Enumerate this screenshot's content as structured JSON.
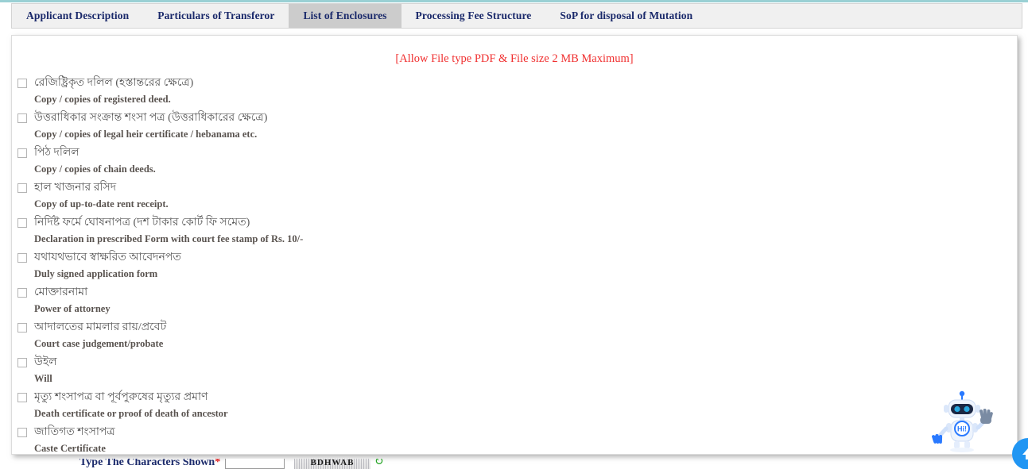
{
  "window": {
    "active_tab": "List of Enclosures"
  },
  "tabs": [
    {
      "label": "Applicant Description",
      "active": false
    },
    {
      "label": "Particulars of Transferor",
      "active": false
    },
    {
      "label": "List of Enclosures",
      "active": true
    },
    {
      "label": "Processing Fee Structure",
      "active": false
    },
    {
      "label": "SoP for disposal of Mutation",
      "active": false
    }
  ],
  "notice": "[Allow File type PDF & File size 2 MB Maximum]",
  "enclosures": [
    {
      "bn": "রেজিষ্ট্রিকৃত দলিল (হস্তান্তরের ক্ষেত্রে)",
      "en": "Copy / copies of registered deed.",
      "checked": false
    },
    {
      "bn": "উত্তরাধিকার সংক্রান্ত শংসা পত্র (উত্তরাধিকারের ক্ষেত্রে)",
      "en": "Copy / copies of legal heir certificate / hebanama etc.",
      "checked": false
    },
    {
      "bn": "পিঠ দলিল",
      "en": "Copy / copies of chain deeds.",
      "checked": false
    },
    {
      "bn": "হাল খাজনার রসিদ",
      "en": "Copy of up-to-date rent receipt.",
      "checked": false
    },
    {
      "bn": "নির্দিষ্ট ফর্মে ঘোষনাপত্র (দশ টাকার কোর্ট ফি সমেত)",
      "en": "Declaration in prescribed Form with court fee stamp of Rs. 10/-",
      "checked": false
    },
    {
      "bn": "যথাযথভাবে স্বাক্ষরিত আবেদনপত",
      "en": "Duly signed application form",
      "checked": false
    },
    {
      "bn": "মোক্তারনামা",
      "en": "Power of attorney",
      "checked": false
    },
    {
      "bn": "আদালতের মামলার রায়/প্রবেট",
      "en": "Court case judgement/probate",
      "checked": false
    },
    {
      "bn": "উইল",
      "en": "Will",
      "checked": false
    },
    {
      "bn": "মৃত্যু শংসাপত্র বা পূর্বপুরুষের মৃত্যুর প্রমাণ",
      "en": "Death certificate or proof of death of ancestor",
      "checked": false
    },
    {
      "bn": "জাতিগত শংসাপত্র",
      "en": "Caste Certificate",
      "checked": false
    }
  ],
  "captcha": {
    "label": "Type The Characters Shown",
    "required_mark": "*",
    "input_value": "",
    "input_placeholder": "",
    "image_text": "BDHWAB",
    "refresh_icon": "refresh-icon"
  },
  "widgets": {
    "chat_robot": {
      "icon": "chat-robot-icon",
      "chest_label": "Hi!"
    },
    "scroll_top": {
      "icon": "arrow-up-icon"
    }
  },
  "colors": {
    "tab_text": "#1b2a6b",
    "active_tab_bg": "#cccccc",
    "notice_red": "#f03030",
    "accent_blue": "#2196f3",
    "top_strip": "#9ad0d4"
  }
}
